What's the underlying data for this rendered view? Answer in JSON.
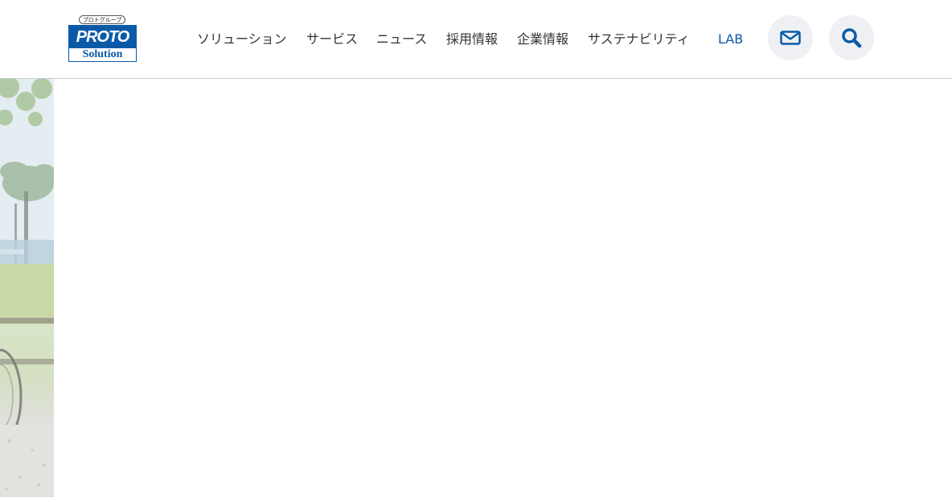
{
  "logo": {
    "group_text": "プロトグループ",
    "brand_text": "PROTO",
    "sub_text": "Solution"
  },
  "nav": {
    "items": [
      {
        "label": "ソリューション"
      },
      {
        "label": "サービス"
      },
      {
        "label": "ニュース"
      },
      {
        "label": "採用情報"
      },
      {
        "label": "企業情報"
      },
      {
        "label": "サステナビリティ"
      },
      {
        "label": "LAB"
      }
    ],
    "contact_icon": "mail-icon",
    "search_icon": "search-icon"
  },
  "colors": {
    "brand": "#0a5aa8",
    "icon_button_bg": "#eef0f3",
    "nav_text": "#333333"
  }
}
